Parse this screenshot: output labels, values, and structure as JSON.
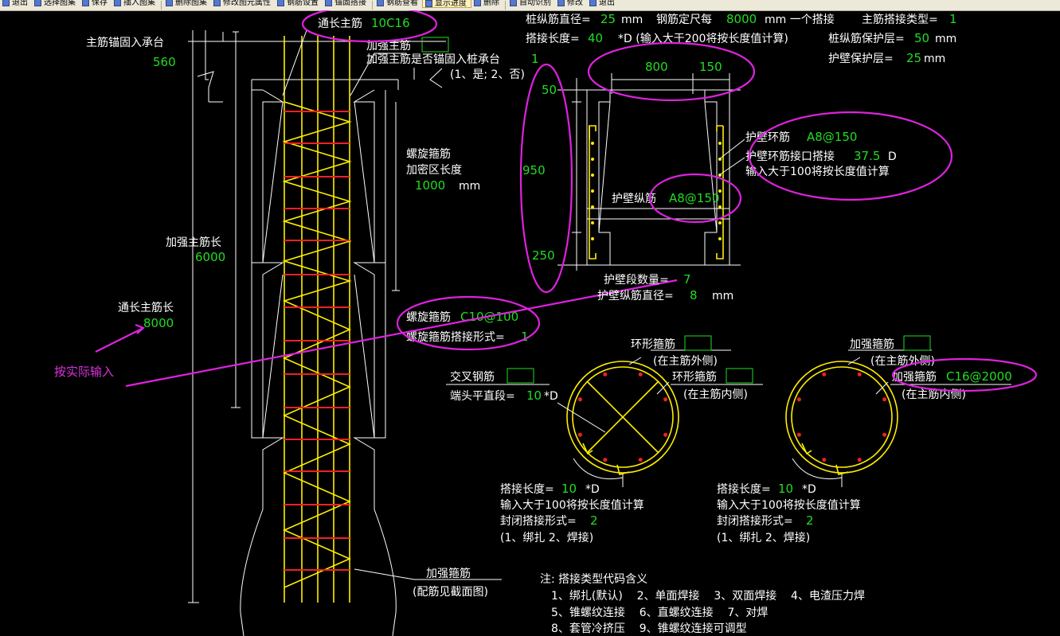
{
  "toolbar": {
    "items": [
      "退出",
      "选择图集",
      "保存",
      "插入图集",
      "删除图集",
      "修改图元属性",
      "钢筋设置",
      "锚固搭接",
      "钢筋查看",
      "显示进度",
      "删除",
      "自动识别",
      "修改",
      "退出"
    ]
  },
  "pile": {
    "main_bar_anchor_label": "主筋锚固入承台",
    "main_bar_anchor_value": "560",
    "through_bar_label": "通长主筋",
    "through_bar_value": "10C16",
    "reinf_bar_label": "加强主筋",
    "reinf_bar_value": "",
    "reinf_anchor_label": "加强主筋是否锚固入桩承台",
    "reinf_anchor_value": "1",
    "reinf_anchor_options": "(1、是; 2、否)",
    "spiral_dense_label_1": "螺旋箍筋",
    "spiral_dense_label_2": "加密区长度",
    "spiral_dense_value": "1000",
    "spiral_dense_unit": "mm",
    "reinf_len_label": "加强主筋长",
    "reinf_len_value": "6000",
    "through_len_label": "通长主筋长",
    "through_len_value": "8000",
    "actual_input_note": "按实际输入",
    "spiral_label": "螺旋箍筋",
    "spiral_value": "C10@100",
    "spiral_lap_label": "螺旋箍筋搭接形式=",
    "spiral_lap_value": "1",
    "bottom_stirrup_label": "加强箍筋",
    "bottom_stirrup_note": "(配筋见截面图)"
  },
  "top_params": {
    "line1": {
      "dia_label": "桩纵筋直径=",
      "dia_value": "25",
      "dia_unit": "mm",
      "len_label": "钢筋定尺每",
      "len_value": "8000",
      "len_unit": "mm 一个搭接",
      "type_label": "主筋搭接类型=",
      "type_value": "1"
    },
    "line2": {
      "lap_label": "搭接长度=",
      "lap_value": "40",
      "lap_note": "*D (输入大于200将按长度值计算)",
      "cover_label": "桩纵筋保护层=",
      "cover_value": "50",
      "cover_unit": "mm"
    },
    "line3": {
      "wall_cover_label": "护壁保护层=",
      "wall_cover_value": "25",
      "wall_cover_unit": "mm"
    }
  },
  "wall": {
    "dim_800": "800",
    "dim_150": "150",
    "dim_50": "50",
    "dim_950": "950",
    "dim_250": "250",
    "ring_label": "护壁环筋",
    "ring_value": "A8@150",
    "ring_lap_label": "护壁环筋接口搭接",
    "ring_lap_value": "37.5",
    "ring_lap_unit": "D",
    "ring_lap_note": "输入大于100将按长度值计算",
    "long_label": "护壁纵筋",
    "long_value": "A8@150",
    "segments_label": "护壁段数量=",
    "segments_value": "7",
    "long_dia_label": "护壁纵筋直径=",
    "long_dia_value": "8",
    "long_dia_unit": "mm"
  },
  "section1": {
    "ring_out_label": "环形箍筋",
    "ring_out_value": "",
    "ring_out_note": "(在主筋外侧)",
    "ring_in_label": "环形箍筋",
    "ring_in_value": "",
    "ring_in_note": "(在主筋内侧)",
    "cross_label": "交叉钢筋",
    "cross_value": "",
    "end_label": "端头平直段=",
    "end_value": "10",
    "end_unit": "*D",
    "lap_label": "搭接长度=",
    "lap_value": "10",
    "lap_unit": "*D",
    "lap_note": "输入大于100将按长度值计算",
    "close_label": "封闭搭接形式=",
    "close_value": "2",
    "close_options": "(1、绑扎  2、焊接)"
  },
  "section2": {
    "reinf_out_label": "加强箍筋",
    "reinf_out_value": "",
    "reinf_out_note": "(在主筋外侧)",
    "reinf_in_label": "加强箍筋",
    "reinf_in_value": "C16@2000",
    "reinf_in_note": "(在主筋内侧)",
    "lap_label": "搭接长度=",
    "lap_value": "10",
    "lap_unit": "*D",
    "lap_note": "输入大于100将按长度值计算",
    "close_label": "封闭搭接形式=",
    "close_value": "2",
    "close_options": "(1、绑扎  2、焊接)"
  },
  "notes": {
    "title": "注: 搭接类型代码含义",
    "row1": "1、绑扎(默认)    2、单面焊接    3、双面焊接    4、电渣压力焊",
    "row2": "5、锥螺纹连接    6、直螺纹连接    7、对焊",
    "row3": "8、套管冷挤压    9、锥螺纹连接可调型"
  },
  "colors": {
    "background": "#000000",
    "line": "#ffffff",
    "rebar": "#ffee00",
    "stirrup": "#ee2222",
    "value": "#22dd22",
    "highlight": "#dd22dd"
  }
}
